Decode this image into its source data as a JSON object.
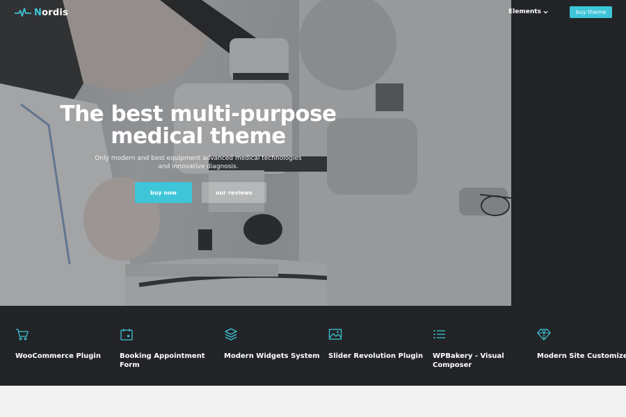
{
  "header": {
    "logo_text": "Nordis",
    "nav_elements_label": "Elements",
    "buy_theme_label": "buy theme"
  },
  "hero": {
    "title_line1": "The best multi-purpose",
    "title_line2": "medical theme",
    "subtitle_line1": "Only modern and best equipment advanced medical technologies",
    "subtitle_line2": "and innovative diagnosis.",
    "buy_now_label": "buy now",
    "reviews_label": "our reviews"
  },
  "features": [
    {
      "label": "WooCommerce Plugin",
      "icon": "cart-icon"
    },
    {
      "label": "Booking Appointment Form",
      "icon": "calendar-icon"
    },
    {
      "label": "Modern Widgets System",
      "icon": "layers-icon"
    },
    {
      "label": "Slider Revolution Plugin",
      "icon": "image-icon"
    },
    {
      "label": "WPBakery - Visual Composer",
      "icon": "list-icon"
    },
    {
      "label": "Modern Site Customizer",
      "icon": "diamond-icon"
    }
  ],
  "colors": {
    "accent": "#3ec5d8",
    "dark": "#222427",
    "light": "#f2f2f2"
  }
}
